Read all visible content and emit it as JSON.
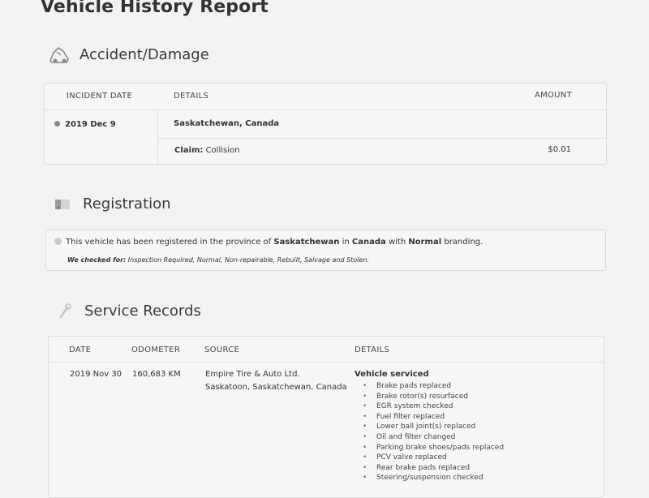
{
  "page": {
    "title": "Vehicle History Report"
  },
  "accident": {
    "title": "Accident/Damage",
    "headers": {
      "date": "INCIDENT DATE",
      "details": "DETAILS",
      "amount": "AMOUNT"
    },
    "record": {
      "date": "2019 Dec 9",
      "location": "Saskatchewan, Canada",
      "claim_label": "Claim:",
      "claim_value": "Collision",
      "amount": "$0.01"
    }
  },
  "registration": {
    "title": "Registration",
    "text_pre": "This vehicle has been registered in the province of",
    "province": "Saskatchewan",
    "text_in": "in",
    "country": "Canada",
    "text_with": "with",
    "branding": "Normal",
    "text_post": "branding.",
    "checked_label": "We checked for:",
    "checked_value": "Inspection Required, Normal, Non-repairable, Rebuilt, Salvage and Stolen."
  },
  "service": {
    "title": "Service Records",
    "headers": {
      "date": "DATE",
      "odometer": "ODOMETER",
      "source": "SOURCE",
      "details": "DETAILS"
    },
    "record": {
      "date": "2019 Nov 30",
      "odometer": "160,683 KM",
      "source_name": "Empire Tire & Auto Ltd.",
      "source_location": "Saskatoon, Saskatchewan, Canada",
      "details_title": "Vehicle serviced",
      "items": [
        "Brake pads replaced",
        "Brake rotor(s) resurfaced",
        "EGR system checked",
        "Fuel filter replaced",
        "Lower ball joint(s) replaced",
        "Oil and filter changed",
        "Parking brake shoes/pads replaced",
        "PCV valve replaced",
        "Rear brake pads replaced",
        "Steering/suspension checked"
      ]
    }
  },
  "colors": {
    "background": "#f3f3f3",
    "card": "#f7f7f7",
    "border": "#dcdcdc",
    "text": "#333333"
  },
  "icons": {
    "accident": "car-crash-icon",
    "registration": "registration-card-icon",
    "service": "wrench-icon",
    "incident_marker": "circle-icon",
    "registration_check": "check-circle-icon"
  }
}
